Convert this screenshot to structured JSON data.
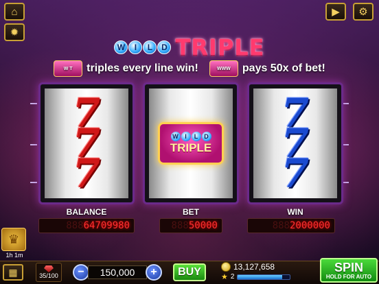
{
  "game": {
    "title_wild": "WILD",
    "title_triple": "TRIPLE",
    "info_left": "triples every line win!",
    "info_right": "pays 50x of bet!"
  },
  "toolbar": {
    "home_icon": "home-icon",
    "sun_icon": "sun-icon",
    "video_icon": "video-icon",
    "settings_icon": "gear-icon"
  },
  "reels": [
    {
      "symbol": "7",
      "color": "red"
    },
    {
      "symbol": "WILD TRIPLE",
      "color": "pink"
    },
    {
      "symbol": "7",
      "color": "blue"
    }
  ],
  "wild_sym": {
    "w": "WILD",
    "t": "TRIPLE"
  },
  "meters": {
    "balance_label": "BALANCE",
    "balance_value": "64709980",
    "balance_ghost": "888",
    "bet_label": "BET",
    "bet_value": "50000",
    "bet_ghost": "888",
    "win_label": "WIN",
    "win_value": "2000000",
    "win_ghost": "888"
  },
  "bonus": {
    "timer": "1h 1m"
  },
  "bottom": {
    "level": "35/100",
    "bet_amount": "150,000",
    "minus": "−",
    "plus": "+",
    "buy_label": "BUY",
    "coins": "13,127,658",
    "stars": "2",
    "xp_fraction": 0.85,
    "spin_label": "SPIN",
    "spin_sub": "HOLD FOR AUTO"
  },
  "colors": {
    "accent_gold": "#c9a035",
    "meter_red": "#ff3030",
    "spin_green": "#4ada3a"
  }
}
